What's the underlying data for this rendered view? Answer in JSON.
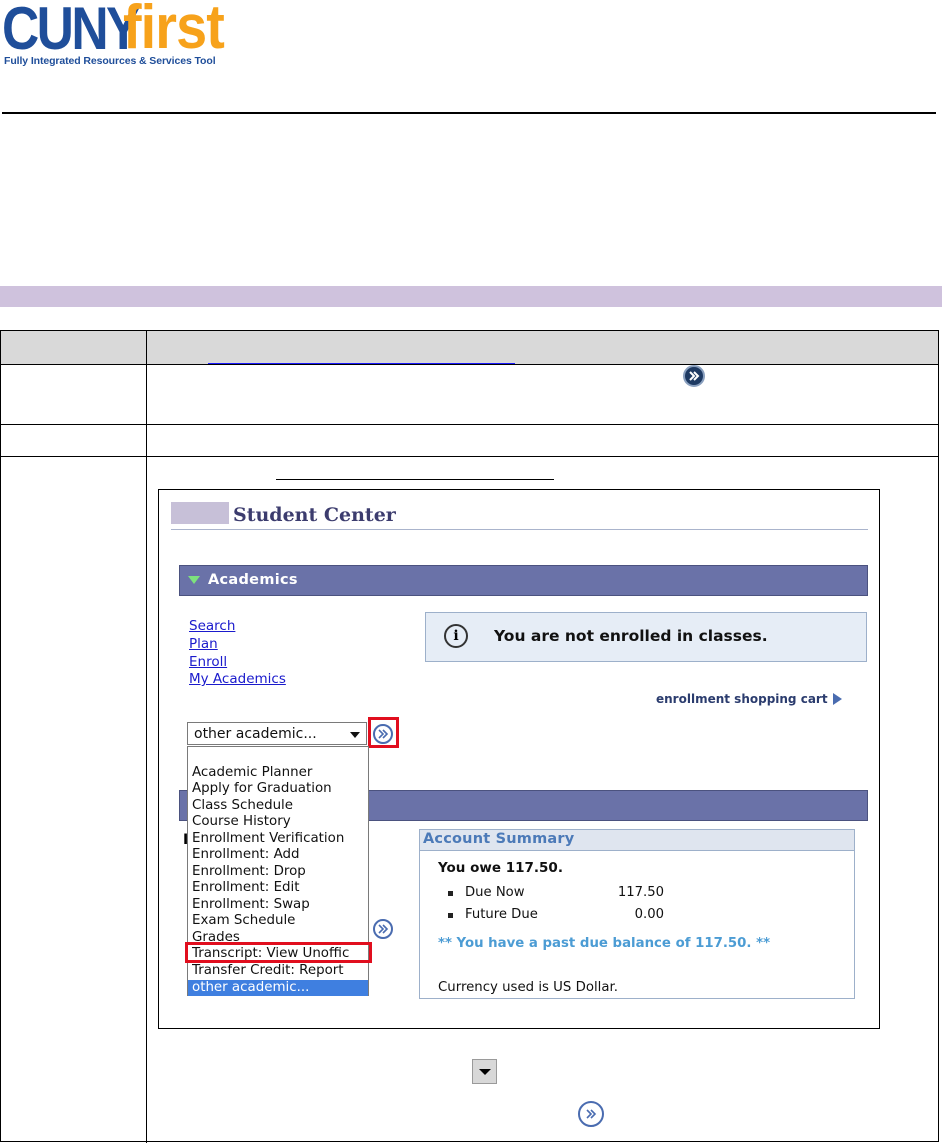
{
  "logo": {
    "brand_part1": "CUNY",
    "brand_part2": "first",
    "tagline": "Fully Integrated Resources & Services Tool",
    "colors": {
      "cuny": "#1f4e9a",
      "first": "#f7a21b"
    }
  },
  "band_color": "#cfc2dd",
  "student_center": {
    "title": "Student Center",
    "academics_label": "Academics",
    "links": [
      "Search",
      "Plan",
      "Enroll",
      "My Academics"
    ],
    "notice": "You are not enrolled in classes.",
    "cart_link": "enrollment shopping cart",
    "select_value": "other academic...",
    "dropdown_options": [
      "Academic Planner",
      "Apply for Graduation",
      "Class Schedule",
      "Course History",
      "Enrollment Verification",
      "Enrollment: Add",
      "Enrollment: Drop",
      "Enrollment: Edit",
      "Enrollment: Swap",
      "Exam Schedule",
      "Grades",
      "Transcript: View Unoffic",
      "Transfer Credit: Report"
    ],
    "dropdown_selected": "other academic...",
    "highlighted_option": "Transcript: View Unoffic",
    "account_summary": {
      "header": "Account Summary",
      "you_owe": "You owe 117.50.",
      "items": [
        {
          "label": "Due Now",
          "amount": "117.50"
        },
        {
          "label": "Future Due",
          "amount": "0.00"
        }
      ],
      "past_due": "** You have a past due balance of 117.50. **",
      "currency": "Currency used is US Dollar."
    }
  },
  "icons": {
    "go_button": "double-chevron-right-icon",
    "dropdown_arrow": "down-arrow-icon"
  }
}
